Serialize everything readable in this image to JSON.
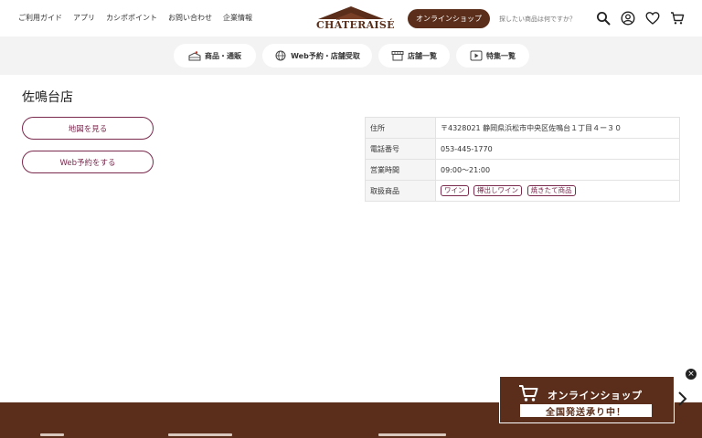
{
  "header": {
    "top_links": [
      "ご利用ガイド",
      "アプリ",
      "カシポポイント",
      "お問い合わせ",
      "企業情報"
    ],
    "logo_text": "CHÂTERAISÉ",
    "online_shop_label": "オンラインショップ",
    "search_placeholder": "探したい商品は何ですか？",
    "icons": [
      "search-icon",
      "account-icon",
      "heart-icon",
      "cart-icon"
    ]
  },
  "categories": [
    {
      "label": "商品・通販",
      "icon": "cake-icon"
    },
    {
      "label": "Web予約・店舗受取",
      "icon": "globe-icon"
    },
    {
      "label": "店舗一覧",
      "icon": "store-icon"
    },
    {
      "label": "特集一覧",
      "icon": "play-icon"
    }
  ],
  "store": {
    "name": "佐鳴台店",
    "map_button": "地図を見る",
    "reserve_button": "Web予約をする",
    "info": {
      "address_label": "住所",
      "address": "〒4328021 静岡県浜松市中央区佐鳴台１丁目４ー３０",
      "phone_label": "電話番号",
      "phone": "053-445-1770",
      "hours_label": "営業時間",
      "hours": "09:00～21:00",
      "products_label": "取扱商品",
      "products": [
        "ワイン",
        "樽出しワイン",
        "焼きたて商品"
      ]
    }
  },
  "banner": {
    "title": "オンラインショップ",
    "subtitle": "全国発送承り中！",
    "close_label": "×"
  },
  "colors": {
    "brand_brown": "#5a2e1a",
    "accent_plum": "#7a2a4d",
    "category_bg": "#f3f3f3"
  }
}
